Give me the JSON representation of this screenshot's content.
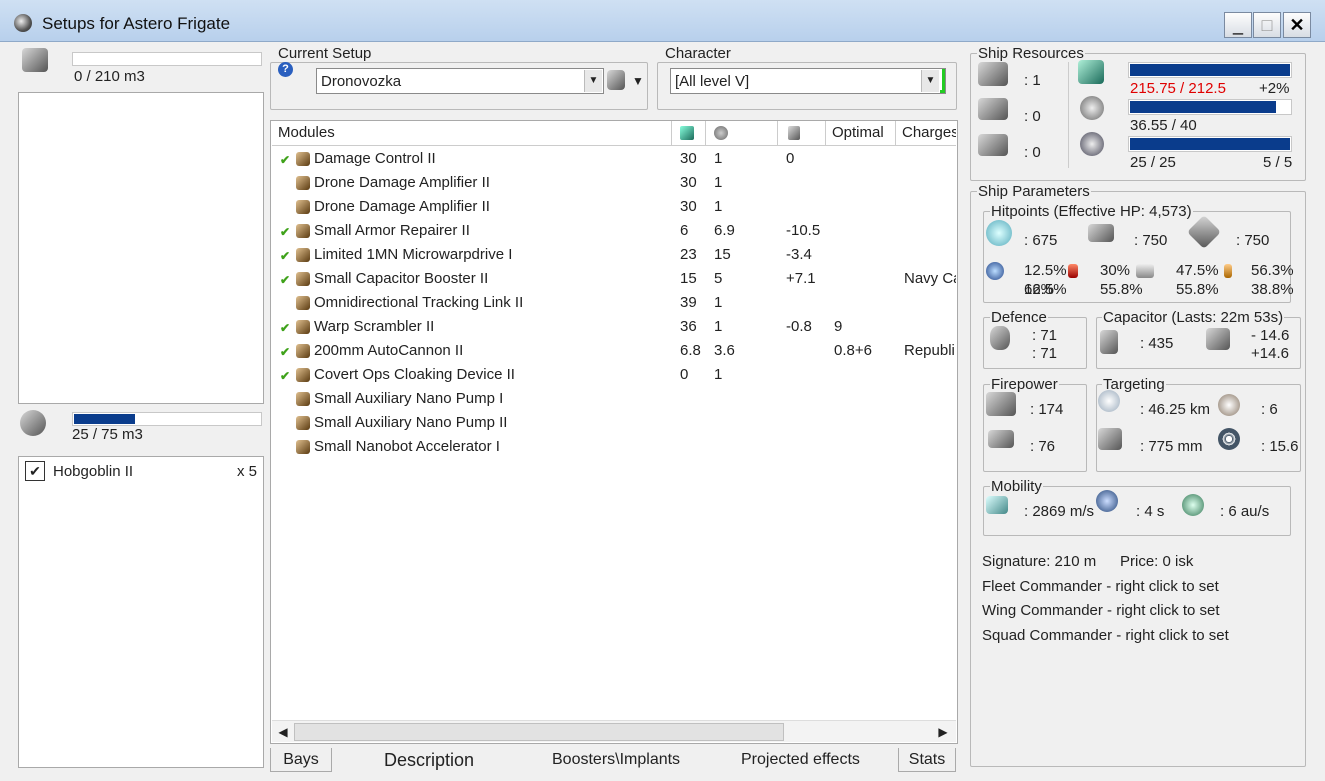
{
  "window": {
    "title": "Setups for Astero Frigate",
    "minimize": "_",
    "maximize": "□",
    "close": "✕"
  },
  "left": {
    "cargo_text": "0 / 210 m3",
    "drone_bay_text": "25 / 75 m3",
    "drone_bay_fill": 0.33,
    "drones": [
      {
        "name": "Hobgoblin II",
        "qty": "x 5",
        "checked": "✔"
      }
    ]
  },
  "setup": {
    "group_label": "Current Setup",
    "help": "?",
    "selected": "Dronovozka"
  },
  "character": {
    "group_label": "Character",
    "selected": "[All level V]"
  },
  "modules": {
    "headers": [
      "Modules",
      "",
      "",
      "",
      "Optimal",
      "Charges"
    ],
    "rows": [
      {
        "check": "✔",
        "name": "Damage Control II",
        "c1": "30",
        "c2": "1",
        "c3": "0",
        "opt": "",
        "charge": ""
      },
      {
        "check": "",
        "name": "Drone Damage Amplifier II",
        "c1": "30",
        "c2": "1",
        "c3": "",
        "opt": "",
        "charge": ""
      },
      {
        "check": "",
        "name": "Drone Damage Amplifier II",
        "c1": "30",
        "c2": "1",
        "c3": "",
        "opt": "",
        "charge": ""
      },
      {
        "check": "✔",
        "name": "Small Armor Repairer II",
        "c1": "6",
        "c2": "6.9",
        "c3": "-10.5",
        "opt": "",
        "charge": ""
      },
      {
        "check": "✔",
        "name": "Limited 1MN Microwarpdrive I",
        "c1": "23",
        "c2": "15",
        "c3": "-3.4",
        "opt": "",
        "charge": ""
      },
      {
        "check": "✔",
        "name": "Small Capacitor Booster II",
        "c1": "15",
        "c2": "5",
        "c3": "+7.1",
        "opt": "",
        "charge": "Navy Ca"
      },
      {
        "check": "",
        "name": "Omnidirectional Tracking Link II",
        "c1": "39",
        "c2": "1",
        "c3": "",
        "opt": "",
        "charge": ""
      },
      {
        "check": "✔",
        "name": "Warp Scrambler II",
        "c1": "36",
        "c2": "1",
        "c3": "-0.8",
        "opt": "9",
        "charge": ""
      },
      {
        "check": "✔",
        "name": "200mm AutoCannon II",
        "c1": "6.8",
        "c2": "3.6",
        "c3": "",
        "opt": "0.8+6",
        "charge": "Republi"
      },
      {
        "check": "✔",
        "name": "Covert Ops Cloaking Device II",
        "c1": "0",
        "c2": "1",
        "c3": "",
        "opt": "",
        "charge": ""
      },
      {
        "check": "",
        "name": "Small Auxiliary Nano Pump I",
        "c1": "",
        "c2": "",
        "c3": "",
        "opt": "",
        "charge": ""
      },
      {
        "check": "",
        "name": "Small Auxiliary Nano Pump II",
        "c1": "",
        "c2": "",
        "c3": "",
        "opt": "",
        "charge": ""
      },
      {
        "check": "",
        "name": "Small Nanobot Accelerator I",
        "c1": "",
        "c2": "",
        "c3": "",
        "opt": "",
        "charge": ""
      }
    ]
  },
  "tabs": [
    "Bays",
    "Description",
    "Boosters\\Implants",
    "Projected effects",
    "Stats"
  ],
  "resources": {
    "group_label": "Ship Resources",
    "hardpoints": [
      ": 1",
      ": 0",
      ": 0"
    ],
    "cpu": {
      "text": "215.75 / 212.5",
      "pct": "+2%",
      "fill": 1.0
    },
    "power": {
      "text": "36.55 / 40",
      "fill": 0.91
    },
    "calibration": {
      "text": "25 / 25",
      "slots": "5 / 5",
      "fill": 1.0
    }
  },
  "params": {
    "group_label": "Ship Parameters",
    "hitpoints": {
      "label": "Hitpoints (Effective HP: 4,573)",
      "shield": ": 675",
      "armor": ": 750",
      "structure": ": 750",
      "res_top": [
        "12.5%",
        "30%",
        "47.5%",
        "56.3%"
      ],
      "res_bottom": [
        "66%",
        "55.8%",
        "55.8%",
        "38.8%"
      ]
    },
    "defence": {
      "label": "Defence",
      "v1": ": 71",
      "v2": ": 71"
    },
    "capacitor": {
      "label": "Capacitor (Lasts: 22m 53s)",
      "value": ": 435",
      "v1": "- 14.6",
      "v2": "+14.6"
    },
    "firepower": {
      "label": "Firepower",
      "v1": ": 174",
      "v2": ": 76"
    },
    "targeting": {
      "label": "Targeting",
      "range": ": 46.25 km",
      "targets": ": 6",
      "res": ": 775 mm",
      "scan": ": 15.6"
    },
    "mobility": {
      "label": "Mobility",
      "speed": ": 2869 m/s",
      "align": ": 4 s",
      "warp": ": 6 au/s"
    },
    "signature": "Signature: 210 m",
    "price": "Price: 0 isk",
    "fleet": "Fleet Commander - right click to set",
    "wing": "Wing Commander - right click to set",
    "squad": "Squad Commander - right click to set"
  },
  "colors": {
    "bar": "#0a3c8c",
    "overfit": "#e00000",
    "check": "#3fa21a"
  }
}
